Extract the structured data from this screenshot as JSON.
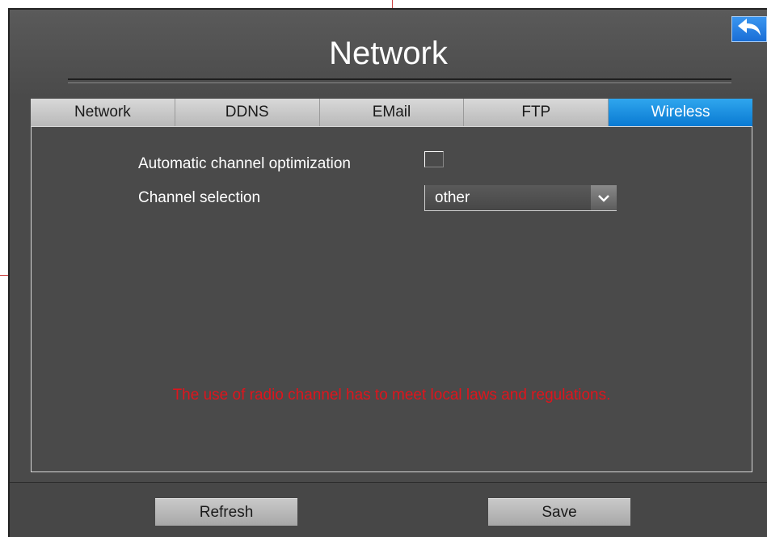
{
  "header": {
    "title": "Network"
  },
  "tabs": [
    {
      "label": "Network",
      "active": false
    },
    {
      "label": "DDNS",
      "active": false
    },
    {
      "label": "EMail",
      "active": false
    },
    {
      "label": "FTP",
      "active": false
    },
    {
      "label": "Wireless",
      "active": true
    }
  ],
  "form": {
    "auto_channel_label": "Automatic channel optimization",
    "auto_channel_checked": false,
    "channel_label": "Channel selection",
    "channel_value": "other"
  },
  "warning": "The use of radio channel has to meet local laws and regulations.",
  "footer": {
    "refresh_label": "Refresh",
    "save_label": "Save"
  },
  "colors": {
    "accent": "#1a84dc",
    "warning": "#e0141c",
    "background": "#4a4a4a"
  },
  "icons": {
    "back": "back-arrow-icon",
    "dropdown": "chevron-down-icon"
  }
}
